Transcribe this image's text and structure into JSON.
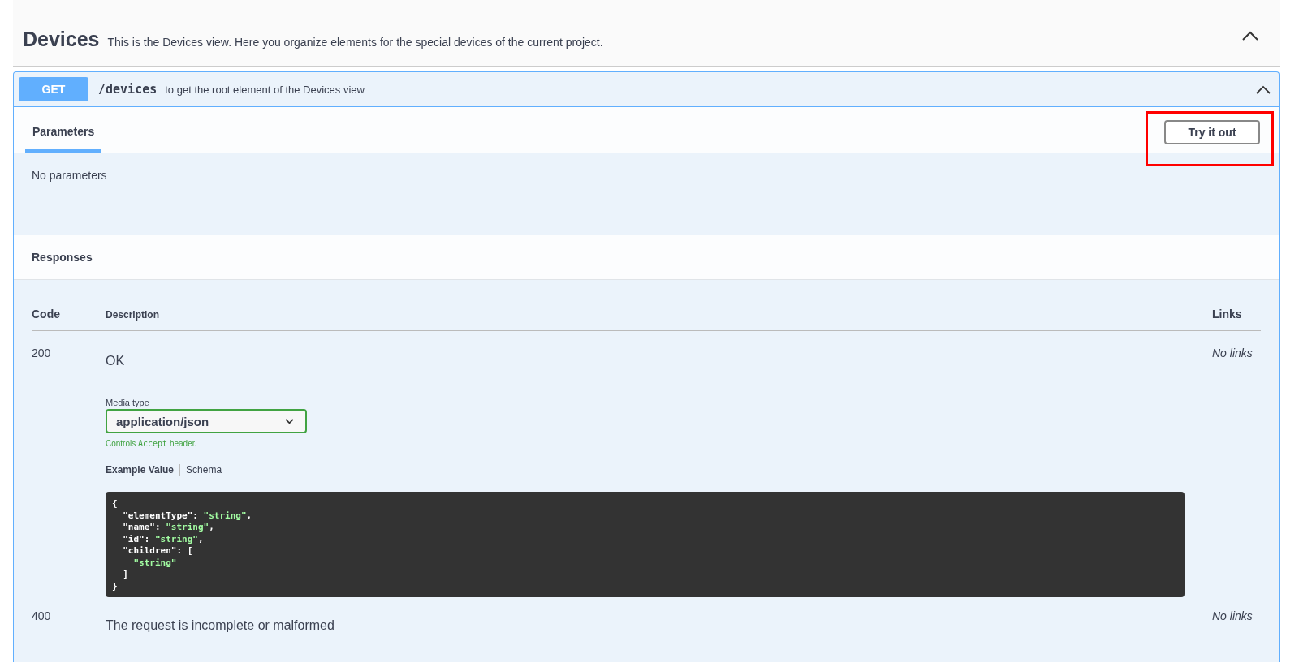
{
  "tag": {
    "title": "Devices",
    "description": "This is the Devices view. Here you organize elements for the special devices of the current project.",
    "expanded": true
  },
  "operation": {
    "method": "GET",
    "path": "/devices",
    "summary": "to get the root element of the Devices view",
    "expanded": true
  },
  "parameters": {
    "tab": "Parameters",
    "try_button": {
      "label": "Try it out",
      "highlighted": true
    },
    "empty_text": "No parameters"
  },
  "responses": {
    "title": "Responses",
    "columns": [
      "Code",
      "Description",
      "Links"
    ],
    "rows": [
      {
        "code": "200",
        "description": "OK",
        "links": "No links",
        "media_type_label": "Media type",
        "media_type": "application/json",
        "media_hint": {
          "before": "Controls",
          "code": "Accept",
          "after": "header."
        },
        "example_tabs": [
          {
            "label": "Example Value",
            "selected": true
          },
          {
            "label": "Schema",
            "selected": false
          }
        ],
        "example": [
          [
            {
              "kind": "punct",
              "text": "{"
            }
          ],
          [
            {
              "kind": "key",
              "text": "\"elementType\""
            },
            {
              "kind": "punct",
              "text": ": "
            },
            {
              "kind": "str",
              "text": "\"string\""
            },
            {
              "kind": "punct",
              "text": ","
            }
          ],
          [
            {
              "kind": "key",
              "text": "\"name\""
            },
            {
              "kind": "punct",
              "text": ": "
            },
            {
              "kind": "str",
              "text": "\"string\""
            },
            {
              "kind": "punct",
              "text": ","
            }
          ],
          [
            {
              "kind": "key",
              "text": "\"id\""
            },
            {
              "kind": "punct",
              "text": ": "
            },
            {
              "kind": "str",
              "text": "\"string\""
            },
            {
              "kind": "punct",
              "text": ","
            }
          ],
          [
            {
              "kind": "key",
              "text": "\"children\""
            },
            {
              "kind": "punct",
              "text": ": ["
            }
          ],
          [
            {
              "kind": "str",
              "text": "\"string\""
            }
          ],
          [
            {
              "kind": "punct",
              "text": "]"
            }
          ],
          [
            {
              "kind": "punct",
              "text": "}"
            }
          ]
        ]
      },
      {
        "code": "400",
        "description": "The request is incomplete or malformed",
        "links": "No links"
      }
    ]
  }
}
